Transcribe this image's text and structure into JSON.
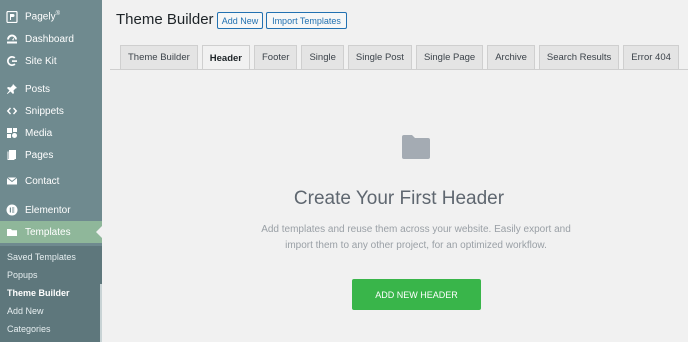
{
  "sidebar": {
    "items": [
      {
        "label": "Pagely",
        "sup": "®",
        "icon": "pagely-logo-icon"
      },
      {
        "label": "Dashboard",
        "icon": "dashboard-icon"
      },
      {
        "label": "Site Kit",
        "icon": "google-g-icon"
      },
      {
        "label": "Posts",
        "icon": "pushpin-icon"
      },
      {
        "label": "Snippets",
        "icon": "code-brackets-icon"
      },
      {
        "label": "Media",
        "icon": "media-icon"
      },
      {
        "label": "Pages",
        "icon": "pages-icon"
      },
      {
        "label": "Contact",
        "icon": "envelope-icon"
      },
      {
        "label": "Elementor",
        "icon": "elementor-icon"
      },
      {
        "label": "Templates",
        "icon": "folder-icon",
        "active": true
      }
    ],
    "submenu": [
      {
        "label": "Saved Templates"
      },
      {
        "label": "Popups"
      },
      {
        "label": "Theme Builder",
        "active": true
      },
      {
        "label": "Add New"
      },
      {
        "label": "Categories"
      }
    ]
  },
  "header": {
    "title": "Theme Builder",
    "add_new": "Add New",
    "import": "Import Templates"
  },
  "tabs": [
    {
      "label": "Theme Builder"
    },
    {
      "label": "Header",
      "active": true
    },
    {
      "label": "Footer"
    },
    {
      "label": "Single"
    },
    {
      "label": "Single Post"
    },
    {
      "label": "Single Page"
    },
    {
      "label": "Archive"
    },
    {
      "label": "Search Results"
    },
    {
      "label": "Error 404"
    }
  ],
  "empty_state": {
    "title": "Create Your First Header",
    "description": "Add templates and reuse them across your website. Easily export and import them to any other project, for an optimized workflow.",
    "button": "ADD NEW HEADER"
  },
  "colors": {
    "sidebar_bg": "#6f8a8f",
    "active_menu": "#8fb79a",
    "primary_button": "#39b54a",
    "link_blue": "#2271b1"
  }
}
